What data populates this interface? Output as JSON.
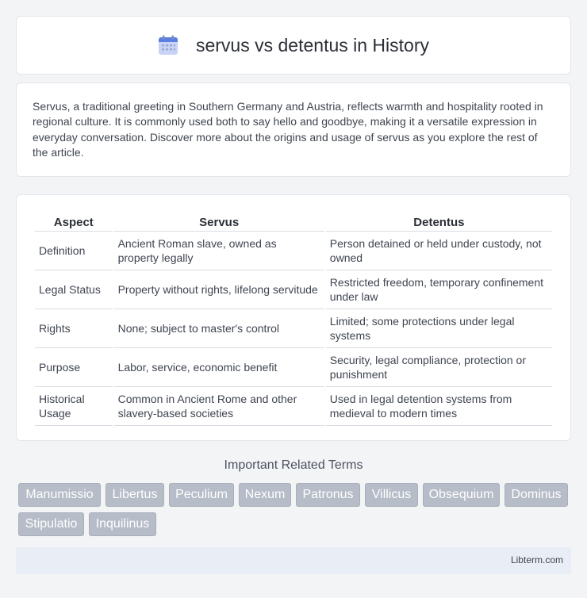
{
  "header": {
    "title": "servus vs detentus in History",
    "logo_icon": "calendar-icon"
  },
  "intro": {
    "text": "Servus, a traditional greeting in Southern Germany and Austria, reflects warmth and hospitality rooted in regional culture. It is commonly used both to say hello and goodbye, making it a versatile expression in everyday conversation. Discover more about the origins and usage of servus as you explore the rest of the article."
  },
  "table": {
    "headers": [
      "Aspect",
      "Servus",
      "Detentus"
    ],
    "rows": [
      [
        "Definition",
        "Ancient Roman slave, owned as property legally",
        "Person detained or held under custody, not owned"
      ],
      [
        "Legal Status",
        "Property without rights, lifelong servitude",
        "Restricted freedom, temporary confinement under law"
      ],
      [
        "Rights",
        "None; subject to master's control",
        "Limited; some protections under legal systems"
      ],
      [
        "Purpose",
        "Labor, service, economic benefit",
        "Security, legal compliance, protection or punishment"
      ],
      [
        "Historical Usage",
        "Common in Ancient Rome and other slavery-based societies",
        "Used in legal detention systems from medieval to modern times"
      ]
    ]
  },
  "related": {
    "title": "Important Related Terms",
    "tags": [
      "Manumissio",
      "Libertus",
      "Peculium",
      "Nexum",
      "Patronus",
      "Villicus",
      "Obsequium",
      "Dominus",
      "Stipulatio",
      "Inquilinus"
    ]
  },
  "footer": {
    "site": "Libterm.com"
  },
  "colors": {
    "tag_bg": "#b6bcc8",
    "footer_bg": "#e8edf6",
    "page_bg": "#f3f4f6"
  }
}
